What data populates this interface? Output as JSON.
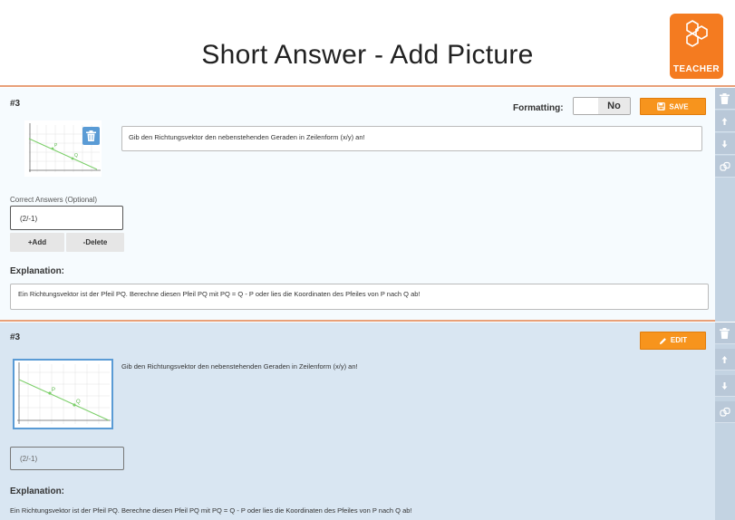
{
  "header": {
    "title": "Short Answer - Add Picture",
    "logo_text": "TEACHER"
  },
  "card_edit": {
    "number": "#3",
    "formatting_label": "Formatting:",
    "formatting_value": "No",
    "save_label": "SAVE",
    "question": "Gib den Richtungsvektor den nebenstehenden Geraden in Zeilenform (x/y) an!",
    "correct_answers_label": "Correct Answers (Optional)",
    "answer_value": "(2/-1)",
    "add_label": "+Add",
    "delete_label": "-Delete",
    "explanation_label": "Explanation:",
    "explanation": "Ein Richtungsvektor ist der Pfeil PQ. Berechne diesen Pfeil PQ  mit PQ = Q - P oder lies die Koordinaten des Pfeiles von P nach Q ab!"
  },
  "card_view": {
    "number": "#3",
    "edit_label": "EDIT",
    "question": "Gib den Richtungsvektor den nebenstehenden Geraden in Zeilenform (x/y) an!",
    "answer_value": "(2/-1)",
    "explanation_label": "Explanation:",
    "explanation": "Ein Richtungsvektor ist der Pfeil PQ. Berechne diesen Pfeil PQ mit PQ = Q - P oder lies die Koordinaten des Pfeiles von P nach Q ab!"
  },
  "graph_labels": {
    "point_p": "P",
    "point_q": "Q"
  },
  "colors": {
    "accent_orange": "#f7941d",
    "logo_orange": "#f47b20",
    "divider": "#e8a079",
    "view_card_bg": "#d9e6f2",
    "trash_blue": "#5a9bd5"
  },
  "icons": {
    "logo": "hexagon-molecule-icon",
    "save": "floppy-disk-icon",
    "edit": "pencil-icon",
    "trash": "trash-icon",
    "up": "arrow-up-icon",
    "down": "arrow-down-icon",
    "duplicate": "duplicate-icon"
  }
}
